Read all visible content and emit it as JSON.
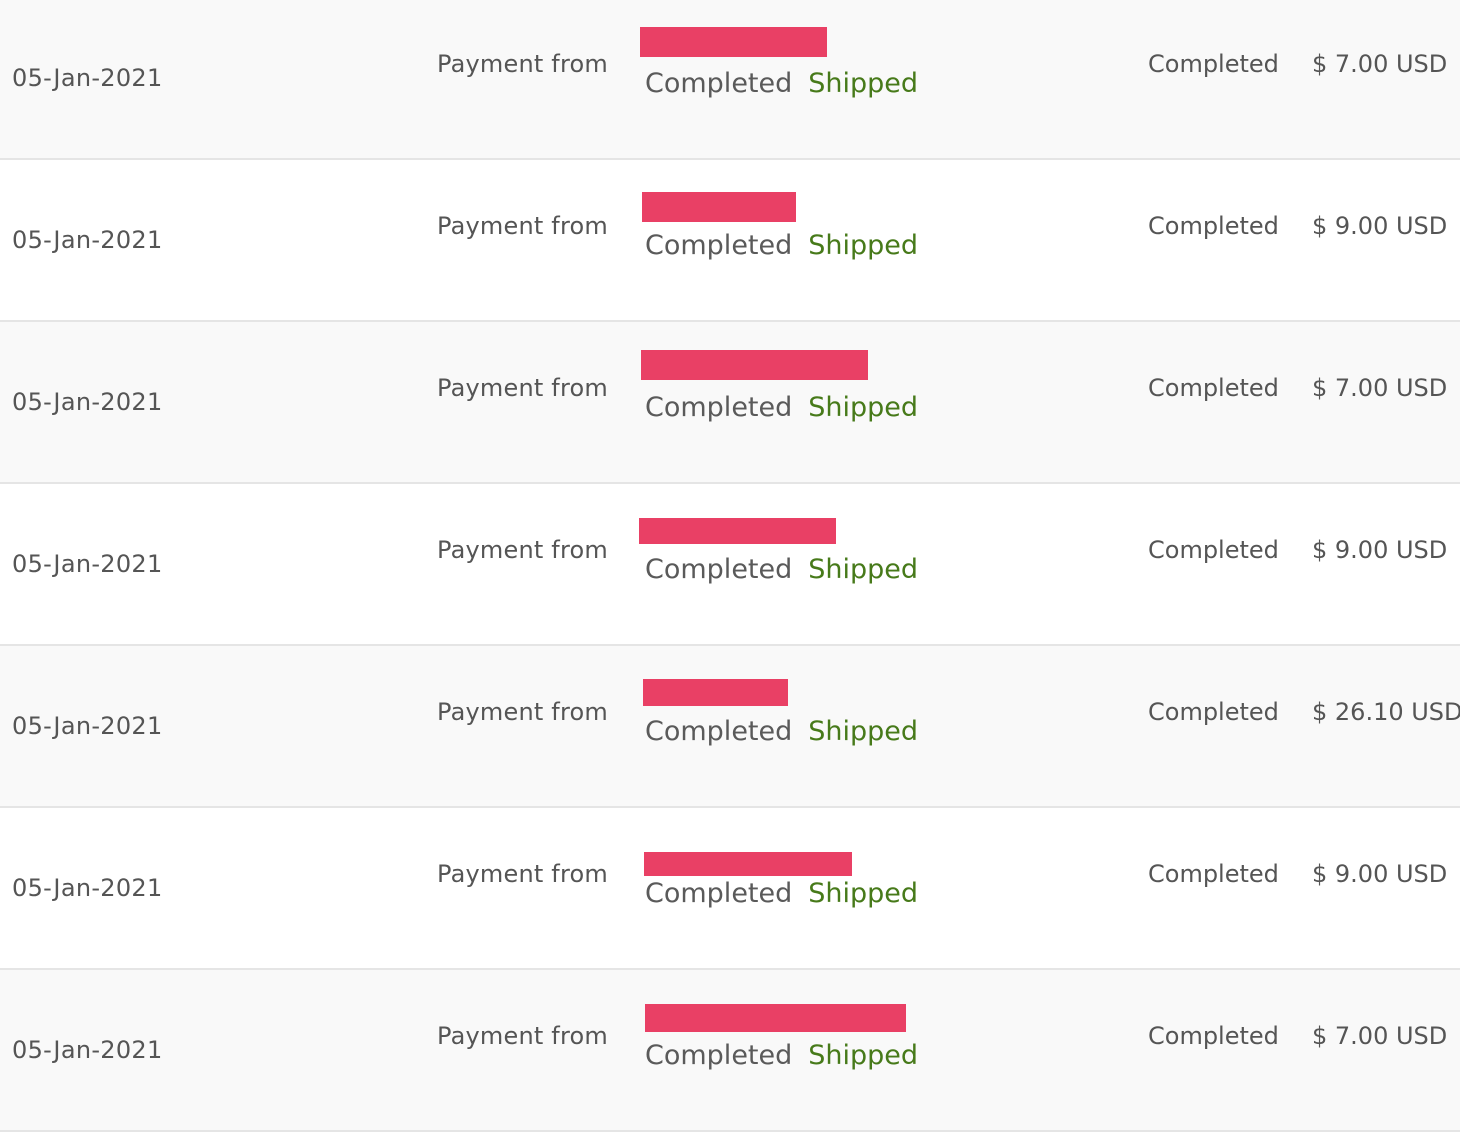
{
  "colors": {
    "redaction": "#e94065",
    "shipped": "#477a1a",
    "text": "#555555",
    "row_alt_bg": "#f9f9f9",
    "divider": "#e5e5e5"
  },
  "transactions": [
    {
      "date": "05-Jan-2021",
      "type": "Payment from",
      "payment_status": "Completed",
      "shipping_status": "Shipped",
      "status": "Completed",
      "amount": "$ 7.00 USD"
    },
    {
      "date": "05-Jan-2021",
      "type": "Payment from",
      "payment_status": "Completed",
      "shipping_status": "Shipped",
      "status": "Completed",
      "amount": "$ 9.00 USD"
    },
    {
      "date": "05-Jan-2021",
      "type": "Payment from",
      "payment_status": "Completed",
      "shipping_status": "Shipped",
      "status": "Completed",
      "amount": "$ 7.00 USD"
    },
    {
      "date": "05-Jan-2021",
      "type": "Payment from",
      "payment_status": "Completed",
      "shipping_status": "Shipped",
      "status": "Completed",
      "amount": "$ 9.00 USD"
    },
    {
      "date": "05-Jan-2021",
      "type": "Payment from",
      "payment_status": "Completed",
      "shipping_status": "Shipped",
      "status": "Completed",
      "amount": "$ 26.10 USD"
    },
    {
      "date": "05-Jan-2021",
      "type": "Payment from",
      "payment_status": "Completed",
      "shipping_status": "Shipped",
      "status": "Completed",
      "amount": "$ 9.00 USD"
    },
    {
      "date": "05-Jan-2021",
      "type": "Payment from",
      "payment_status": "Completed",
      "shipping_status": "Shipped",
      "status": "Completed",
      "amount": "$ 7.00 USD"
    }
  ]
}
